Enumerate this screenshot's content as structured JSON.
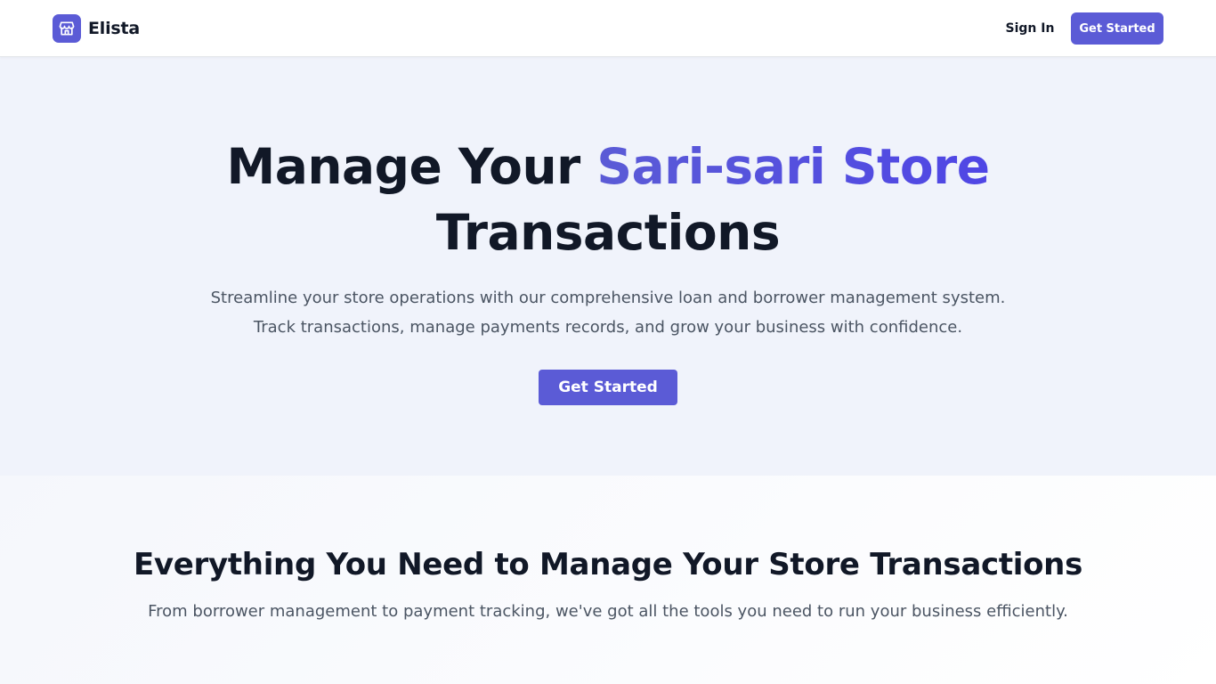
{
  "header": {
    "brand_name": "Elista",
    "logo_icon": "store-icon",
    "sign_in_label": "Sign In",
    "get_started_label": "Get Started"
  },
  "hero": {
    "title_part1": "Manage Your ",
    "title_accent": "Sari-sari Store",
    "title_part2": "Transactions",
    "subtitle_line1": "Streamline your store operations with our comprehensive loan and borrower management system.",
    "subtitle_line2": "Track transactions, manage payments records, and grow your business with confidence.",
    "cta_label": "Get Started"
  },
  "features": {
    "title": "Everything You Need to Manage Your Store Transactions",
    "subtitle": "From borrower management to payment tracking, we've got all the tools you need to run your business efficiently."
  },
  "colors": {
    "brand": "#5b5bd6",
    "accent_gradient_end": "#4f46e5",
    "hero_background": "#f0f3fb",
    "text_dark": "#111827",
    "text_muted": "#4b5563"
  }
}
